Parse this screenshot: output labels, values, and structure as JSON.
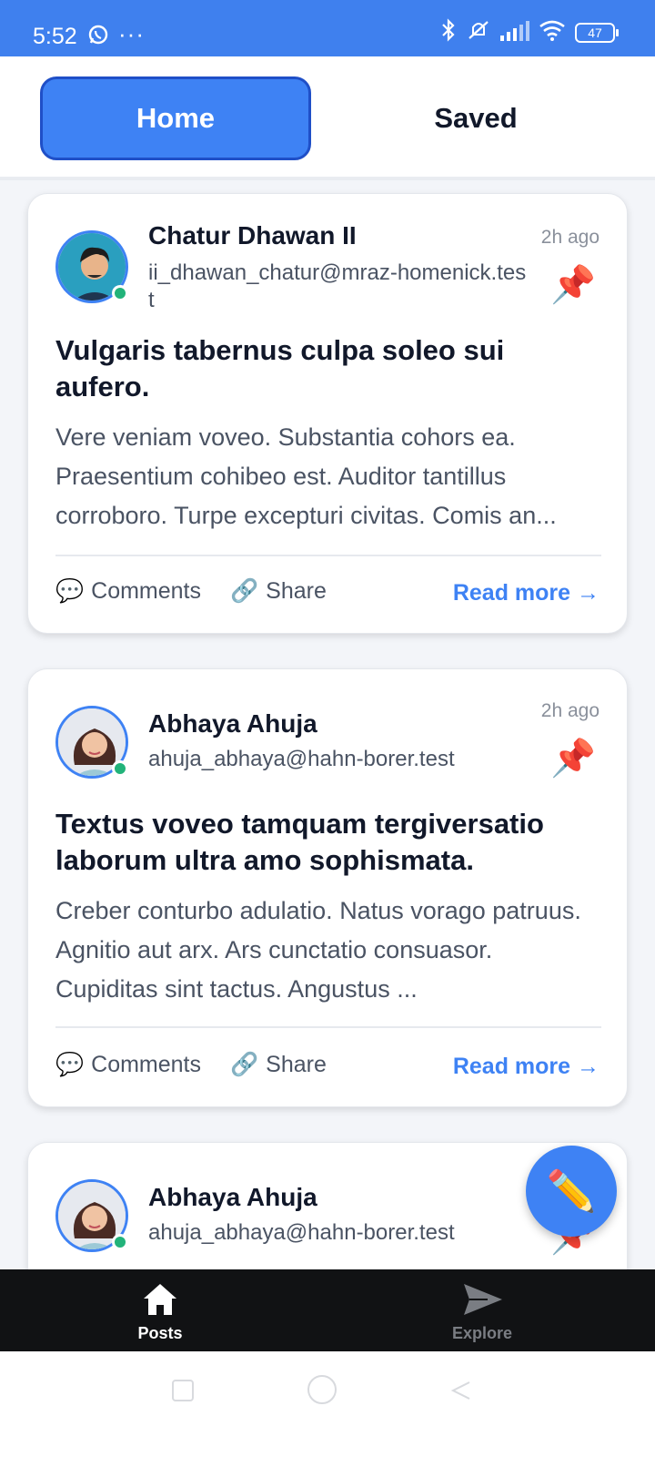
{
  "status_bar": {
    "time": "5:52",
    "dots": "···",
    "battery": "47"
  },
  "tabs": [
    {
      "label": "Home"
    },
    {
      "label": "Saved"
    }
  ],
  "posts": [
    {
      "author": "Chatur Dhawan II",
      "email": "ii_dhawan_chatur@mraz-homenick.test",
      "time": "2h ago",
      "title": "Vulgaris tabernus culpa soleo sui aufero.",
      "body": "Vere veniam voveo. Substantia cohors ea. Praesentium cohibeo est. Auditor tantillus corroboro. Turpe excepturi civitas. Comis an...",
      "comments_label": "Comments",
      "share_label": "Share",
      "read_more": "Read more →"
    },
    {
      "author": "Abhaya Ahuja",
      "email": "ahuja_abhaya@hahn-borer.test",
      "time": "2h ago",
      "title": "Textus voveo tamquam tergiversatio laborum ultra amo sophismata.",
      "body": "Creber conturbo adulatio. Natus vorago patruus. Agnitio aut arx. Ars cunctatio consuasor. Cupiditas sint tactus. Angustus ...",
      "comments_label": "Comments",
      "share_label": "Share",
      "read_more": "Read more →"
    },
    {
      "author": "Abhaya Ahuja",
      "email": "ahuja_abhaya@hahn-borer.test"
    }
  ],
  "bottom_nav": [
    {
      "label": "Posts",
      "icon": "home-icon"
    },
    {
      "label": "Explore",
      "icon": "send-icon"
    }
  ],
  "icons": {
    "comment": "💬",
    "share": "🔗",
    "pin": "📌",
    "fab": "✏️"
  },
  "colors": {
    "accent": "#3e82f4",
    "status_bar": "#3f80ee",
    "online": "#22b37a",
    "nav_bg": "#111214"
  }
}
